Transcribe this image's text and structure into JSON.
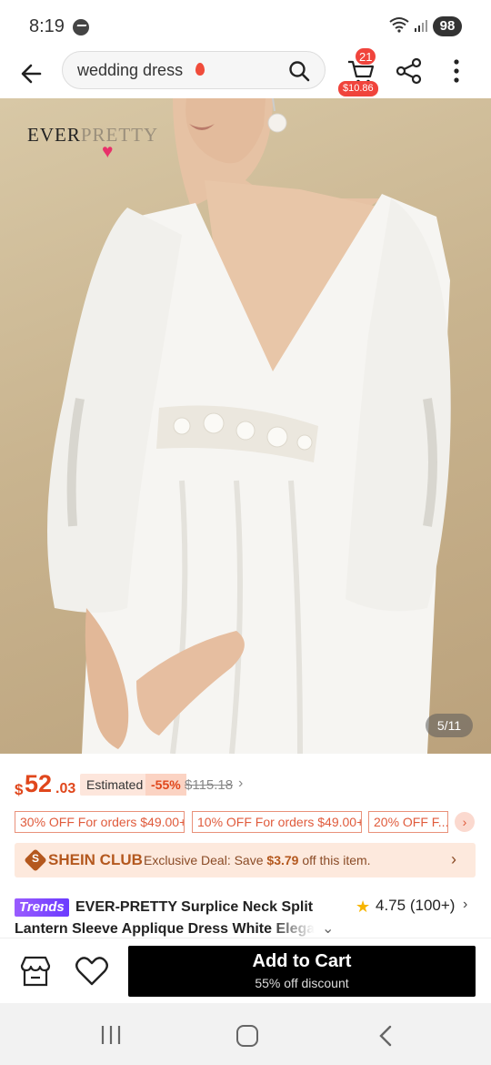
{
  "status_bar": {
    "time": "8:19",
    "battery": "98"
  },
  "search": {
    "query": "wedding dress"
  },
  "cart": {
    "badge": "21",
    "amount": "$10.86"
  },
  "product_image": {
    "brand_left": "EVER",
    "brand_right": "PRETTY",
    "counter": "5/11"
  },
  "price": {
    "currency": "$",
    "integer": "52",
    "decimal": ".03",
    "estimated_label": "Estimated",
    "discount": "-55%",
    "original": "$115.18"
  },
  "coupons": [
    "30% OFF For orders $49.00+",
    "10% OFF For orders $49.00+",
    "20% OFF F..."
  ],
  "club": {
    "name": "SHEIN CLUB",
    "deal_prefix": "Exclusive Deal: Save ",
    "deal_amount": "$3.79",
    "deal_suffix": " off this item."
  },
  "product": {
    "tag": "Trends",
    "title_line1": "EVER-PRETTY Surplice Neck Split",
    "title_line2": "Lantern Sleeve Applique Dress White Elegant",
    "rating": "4.75",
    "review_count": "(100+)"
  },
  "action": {
    "add_to_cart": "Add to Cart",
    "discount_note": "55% off discount"
  },
  "colors": {
    "accent": "#e0471c",
    "club": "#b4581e",
    "cta": "#000000"
  }
}
